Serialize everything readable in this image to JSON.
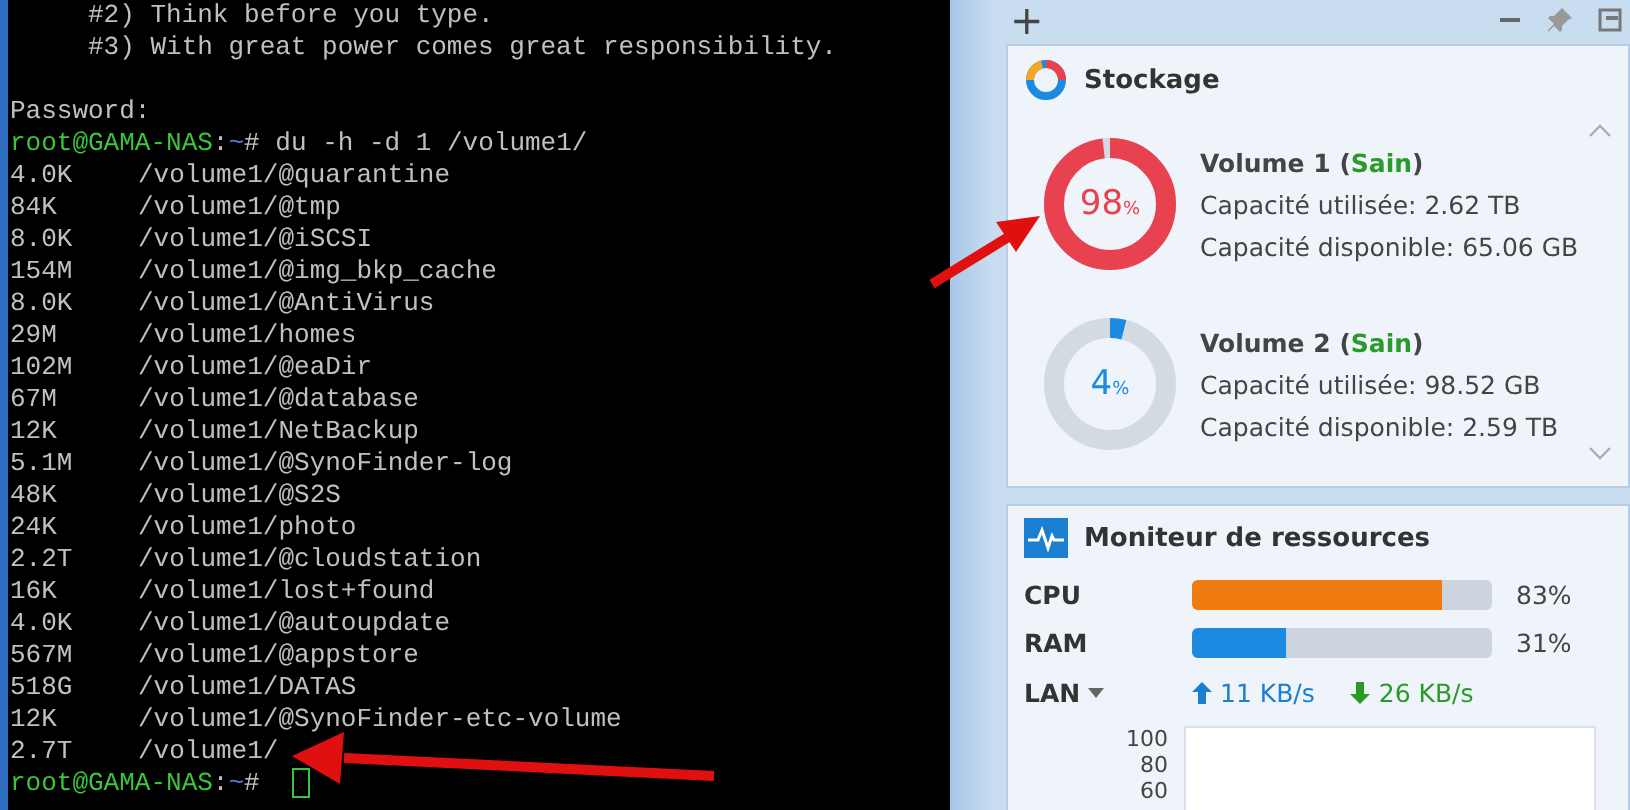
{
  "terminal": {
    "lines": [
      "     #2) Think before you type.",
      "     #3) With great power comes great responsibility."
    ],
    "password_label": "Password:",
    "prompt": {
      "user": "root@GAMA-NAS",
      "separator": ":",
      "path": "~",
      "symbol": "#",
      "command": "du -h -d 1 /volume1/"
    },
    "rows": [
      {
        "size": "4.0K",
        "path": "/volume1/@quarantine"
      },
      {
        "size": "84K",
        "path": "/volume1/@tmp"
      },
      {
        "size": "8.0K",
        "path": "/volume1/@iSCSI"
      },
      {
        "size": "154M",
        "path": "/volume1/@img_bkp_cache"
      },
      {
        "size": "8.0K",
        "path": "/volume1/@AntiVirus"
      },
      {
        "size": "29M",
        "path": "/volume1/homes"
      },
      {
        "size": "102M",
        "path": "/volume1/@eaDir"
      },
      {
        "size": "67M",
        "path": "/volume1/@database"
      },
      {
        "size": "12K",
        "path": "/volume1/NetBackup"
      },
      {
        "size": "5.1M",
        "path": "/volume1/@SynoFinder-log"
      },
      {
        "size": "48K",
        "path": "/volume1/@S2S"
      },
      {
        "size": "24K",
        "path": "/volume1/photo"
      },
      {
        "size": "2.2T",
        "path": "/volume1/@cloudstation"
      },
      {
        "size": "16K",
        "path": "/volume1/lost+found"
      },
      {
        "size": "4.0K",
        "path": "/volume1/@autoupdate"
      },
      {
        "size": "567M",
        "path": "/volume1/@appstore"
      },
      {
        "size": "518G",
        "path": "/volume1/DATAS"
      },
      {
        "size": "12K",
        "path": "/volume1/@SynoFinder-etc-volume"
      },
      {
        "size": "2.7T",
        "path": "/volume1/"
      }
    ],
    "final_prompt": {
      "user": "root@GAMA-NAS",
      "separator": ":",
      "path": "~",
      "symbol": "#"
    }
  },
  "panel": {
    "toolbar": {
      "add": "+"
    },
    "storage": {
      "title": "Stockage",
      "volumes": [
        {
          "name": "Volume 1",
          "status": "Sain",
          "brackets": [
            "(",
            ")"
          ],
          "percent": "98",
          "unit": "%",
          "color": "#e8414f",
          "used": "Capacité utilisée: 2.62 TB",
          "free": "Capacité disponible: 65.06 GB"
        },
        {
          "name": "Volume 2",
          "status": "Sain",
          "brackets": [
            "(",
            ")"
          ],
          "percent": "4",
          "unit": "%",
          "color": "#1a8be0",
          "used": "Capacité utilisée: 98.52 GB",
          "free": "Capacité disponible: 2.59 TB"
        }
      ]
    },
    "monitor": {
      "title": "Moniteur de ressources",
      "meters": [
        {
          "label": "CPU",
          "level": 0.83,
          "reading": "83%",
          "color": "#f07b10"
        },
        {
          "label": "RAM",
          "level": 0.31,
          "reading": "31%",
          "color": "#1a8be0"
        }
      ],
      "lan": {
        "label": "LAN",
        "up": "11 KB/s",
        "down": "26 KB/s",
        "ticks": [
          "100",
          "80",
          "60"
        ]
      }
    }
  }
}
